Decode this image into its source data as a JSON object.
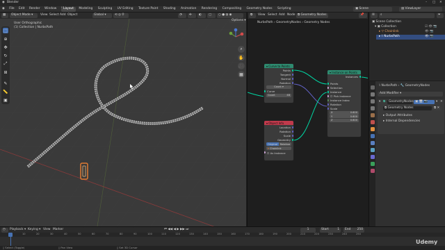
{
  "app": {
    "title": "Blender"
  },
  "menu": [
    "File",
    "Edit",
    "Render",
    "Window",
    "Help"
  ],
  "workspaces": [
    {
      "label": "Layout",
      "active": true
    },
    {
      "label": "Modeling"
    },
    {
      "label": "Sculpting"
    },
    {
      "label": "UV Editing"
    },
    {
      "label": "Texture Paint"
    },
    {
      "label": "Shading"
    },
    {
      "label": "Animation"
    },
    {
      "label": "Rendering"
    },
    {
      "label": "Compositing"
    },
    {
      "label": "Geometry Nodes"
    },
    {
      "label": "Scripting"
    }
  ],
  "topright": {
    "scene": "Scene",
    "view_layer": "ViewLayer"
  },
  "viewport": {
    "mode": "Object Mode",
    "menus": [
      "View",
      "Select",
      "Add",
      "Object"
    ],
    "orientation": "Global",
    "info_line1": "User Orthographic",
    "info_line2": "(1) Collection | NurbsPath",
    "options": "Options"
  },
  "node_editor": {
    "menus": [
      "View",
      "Select",
      "Add",
      "Node"
    ],
    "tree_name": "Geometry Nodes",
    "breadcrumb": [
      "NurbsPath",
      "GeometryNodes",
      "Geometry Nodes"
    ],
    "nodes": {
      "curve_to_points": {
        "title": "Curve to Points",
        "outputs": [
          "Points",
          "Tangent",
          "Normal",
          "Rotation"
        ],
        "mode": "Count",
        "inputs": [
          "Curve"
        ],
        "count_label": "Count",
        "count_value": "48"
      },
      "instance_on_points": {
        "title": "Instance on Points",
        "output": "Instances",
        "inputs": [
          "Points",
          "Selection",
          "Instance",
          "Pick Instance",
          "Instance Index",
          "Rotation",
          "Scale"
        ],
        "scale": [
          {
            "axis": "X",
            "value": "0.600"
          },
          {
            "axis": "Y",
            "value": "0.600"
          },
          {
            "axis": "Z",
            "value": "0.600"
          }
        ]
      },
      "object_info": {
        "title": "Object Info",
        "outputs": [
          "Location",
          "Rotation",
          "Scale",
          "Geometry"
        ],
        "toggle": [
          "Original",
          "Relative"
        ],
        "object": "Chainlink",
        "as_instance": "As Instance"
      }
    }
  },
  "outliner": {
    "items": [
      {
        "label": "Scene Collection"
      },
      {
        "label": "Collection"
      },
      {
        "label": "Chainlink"
      },
      {
        "label": "NurbsPath"
      }
    ]
  },
  "properties": {
    "breadcrumb": [
      "NurbsPath",
      "GeometryNodes"
    ],
    "add_modifier": "Add Modifier",
    "modifier_name": "GeometryNodes",
    "node_group": "Geometry Nodes",
    "panels": [
      "Output Attributes",
      "Internal Dependencies"
    ]
  },
  "timeline": {
    "menus": [
      "Playback",
      "Keying",
      "View",
      "Marker"
    ],
    "current_frame": "1",
    "start_label": "Start",
    "start": "1",
    "end_label": "End",
    "end": "250",
    "ticks": [
      "0",
      "10",
      "20",
      "30",
      "40",
      "50",
      "60",
      "70",
      "80",
      "90",
      "100",
      "110",
      "120",
      "130",
      "140",
      "150",
      "160",
      "170",
      "180",
      "190",
      "200",
      "210",
      "220",
      "230",
      "240",
      "250"
    ]
  },
  "statusbar": {
    "items": [
      "Select (Toggle)",
      "Pan View",
      "Set 3D Cursor"
    ]
  },
  "watermark": "Udemy",
  "colors": {
    "accent": "#4772b3",
    "geo_socket": "#00d6a3",
    "vec_socket": "#6363c7",
    "float_socket": "#a1a1a1",
    "bool_socket": "#cca6d6",
    "int_socket": "#598c5c",
    "node_geo_header": "#2e8a6f",
    "node_input_header": "#c13a4c"
  }
}
